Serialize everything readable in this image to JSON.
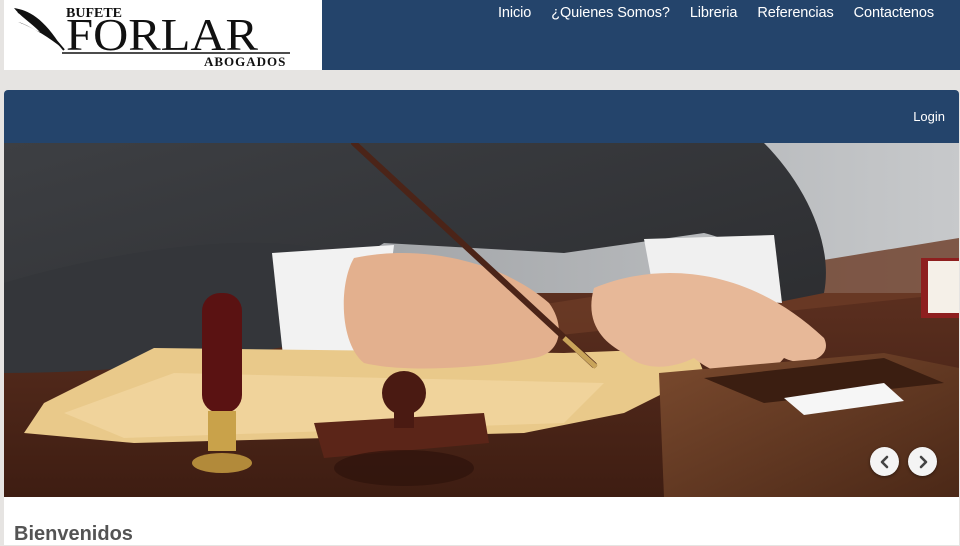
{
  "brand": {
    "line1": "BUFETE",
    "line2": "FORLAR",
    "line3": "ABOGADOS"
  },
  "nav": {
    "items": [
      {
        "label": "Inicio"
      },
      {
        "label": "¿Quienes Somos?"
      },
      {
        "label": "Libreria"
      },
      {
        "label": "Referencias"
      },
      {
        "label": "Contactenos"
      }
    ]
  },
  "account": {
    "login_label": "Login"
  },
  "carousel": {
    "prev_icon": "chevron-left-icon",
    "next_icon": "chevron-right-icon"
  },
  "main": {
    "heading": "Bienvenidos"
  },
  "colors": {
    "navbar": "#24446b",
    "page_background": "#e6e4e2",
    "heading_text": "#545454"
  }
}
